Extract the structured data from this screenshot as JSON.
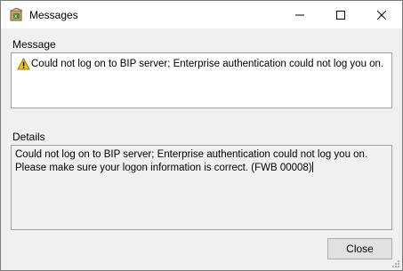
{
  "window": {
    "title": "Messages",
    "app_icon": "app-package-icon",
    "controls": {
      "minimize_icon": "minimize-icon",
      "maximize_icon": "maximize-icon",
      "close_icon": "close-icon"
    }
  },
  "message": {
    "label": "Message",
    "icon": "warning-icon",
    "text": "Could not log on to BIP server; Enterprise authentication could not log you on. Plea..."
  },
  "details": {
    "label": "Details",
    "text": "Could not log on to BIP server; Enterprise authentication could not log you on. Please make sure your logon information is correct. (FWB 00008)"
  },
  "footer": {
    "close_label": "Close"
  },
  "colors": {
    "titlebar": "#ffffff",
    "body": "#f0f0f0",
    "warning": "#f5c400"
  }
}
